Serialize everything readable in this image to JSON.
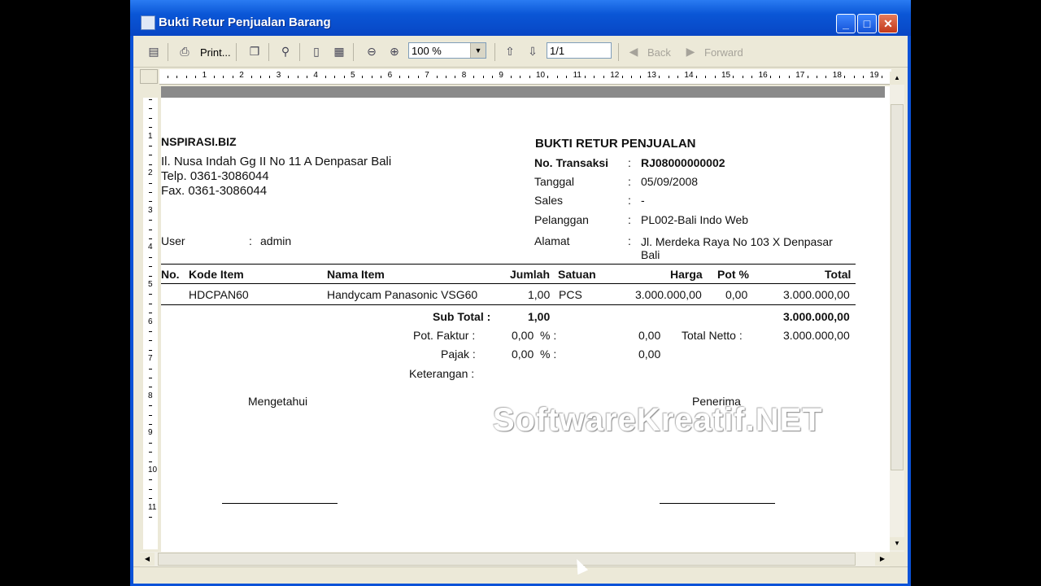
{
  "window": {
    "title": "Bukti Retur Penjualan Barang"
  },
  "toolbar": {
    "print_label": "Print...",
    "zoom_value": "100 %",
    "page_value": "1/1",
    "back_label": "Back",
    "forward_label": "Forward"
  },
  "ruler": {
    "h_numbers": [
      "1",
      "2",
      "3",
      "4",
      "5",
      "6",
      "7",
      "8",
      "9",
      "10",
      "11",
      "12",
      "13",
      "14",
      "15",
      "16",
      "17",
      "18",
      "19"
    ],
    "v_numbers": [
      "1",
      "2",
      "3",
      "4",
      "5",
      "6",
      "7",
      "8",
      "9",
      "10",
      "11"
    ]
  },
  "report": {
    "company": {
      "name": "NSPIRASI.BIZ",
      "address": "Il. Nusa Indah Gg II No 11 A Denpasar Bali",
      "phone": "Telp. 0361-3086044",
      "fax": "Fax. 0361-3086044"
    },
    "user": {
      "label": "User",
      "colon": ":",
      "value": "admin"
    },
    "heading": "BUKTI RETUR PENJUALAN",
    "meta": [
      {
        "label": "No. Transaksi",
        "colon": ":",
        "value": "RJ08000000002",
        "bold": true
      },
      {
        "label": "Tanggal",
        "colon": ":",
        "value": "05/09/2008"
      },
      {
        "label": "Sales",
        "colon": ":",
        "value": "-"
      },
      {
        "label": "Pelanggan",
        "colon": ":",
        "value": "PL002-Bali Indo Web"
      },
      {
        "label": "Alamat",
        "colon": ":",
        "value": "Jl. Merdeka Raya No 103 X Denpasar",
        "value2": "Bali"
      }
    ],
    "table": {
      "headers": {
        "no": "No.",
        "kode": "Kode Item",
        "nama": "Nama Item",
        "jumlah": "Jumlah",
        "satuan": "Satuan",
        "harga": "Harga",
        "pot": "Pot %",
        "total": "Total"
      },
      "rows": [
        {
          "no": "",
          "kode": "HDCPAN60",
          "nama": "Handycam Panasonic VSG60",
          "jumlah": "1,00",
          "satuan": "PCS",
          "harga": "3.000.000,00",
          "pot": "0,00",
          "total": "3.000.000,00"
        }
      ]
    },
    "summary": {
      "subtotal_label": "Sub Total :",
      "subtotal_qty": "1,00",
      "subtotal_value": "3.000.000,00",
      "pot_faktur_label": "Pot. Faktur :",
      "pot_faktur_pct": "0,00",
      "pot_faktur_pct_sign": "% :",
      "pot_faktur_value": "0,00",
      "pajak_label": "Pajak :",
      "pajak_pct": "0,00",
      "pajak_pct_sign": "% :",
      "pajak_value": "0,00",
      "total_netto_label": "Total Netto :",
      "total_netto_value": "3.000.000,00",
      "keterangan_label": "Keterangan :"
    },
    "signatures": {
      "left": "Mengetahui",
      "right": "Penerima"
    }
  },
  "watermark": "SoftwareKreatif.NET"
}
